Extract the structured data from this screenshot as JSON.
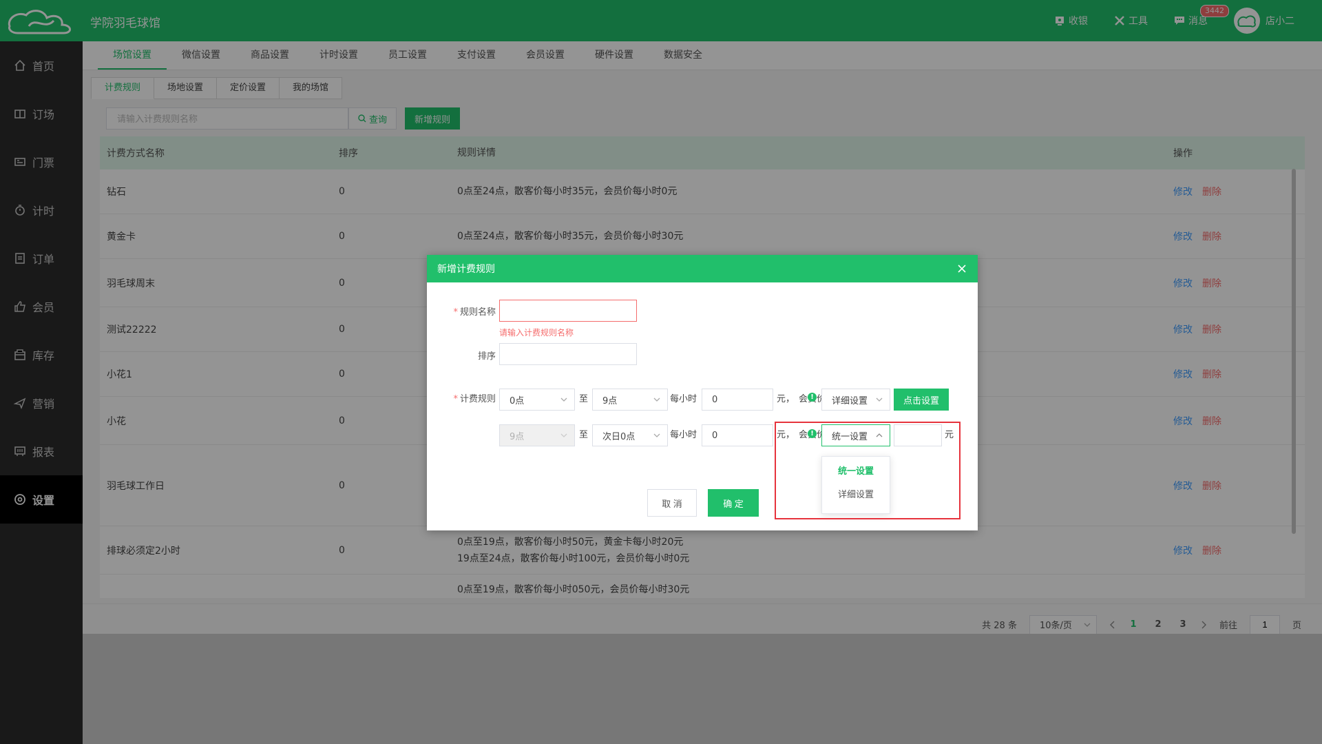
{
  "header": {
    "venue_name": "学院羽毛球馆",
    "actions": [
      {
        "label": "收银",
        "icon": "cashier-icon"
      },
      {
        "label": "工具",
        "icon": "tools-icon"
      },
      {
        "label": "消息",
        "icon": "message-icon",
        "badge": "3442"
      }
    ],
    "user_name": "店小二"
  },
  "sidebar": {
    "items": [
      {
        "label": "首页",
        "icon": "home-icon"
      },
      {
        "label": "订场",
        "icon": "booking-icon"
      },
      {
        "label": "门票",
        "icon": "ticket-icon"
      },
      {
        "label": "计时",
        "icon": "timer-icon"
      },
      {
        "label": "订单",
        "icon": "order-icon"
      },
      {
        "label": "会员",
        "icon": "member-icon"
      },
      {
        "label": "库存",
        "icon": "inventory-icon"
      },
      {
        "label": "营销",
        "icon": "marketing-icon"
      },
      {
        "label": "报表",
        "icon": "report-icon"
      },
      {
        "label": "设置",
        "icon": "settings-icon",
        "active": true
      }
    ]
  },
  "tabs": [
    "场馆设置",
    "微信设置",
    "商品设置",
    "计时设置",
    "员工设置",
    "支付设置",
    "会员设置",
    "硬件设置",
    "数据安全"
  ],
  "subtabs": [
    "计费规则",
    "场地设置",
    "定价设置",
    "我的场馆"
  ],
  "search": {
    "placeholder": "请输入计费规则名称",
    "query_label": "查询",
    "add_label": "新增规则"
  },
  "table": {
    "headers": [
      "计费方式名称",
      "排序",
      "规则详情",
      "操作"
    ],
    "edit_label": "修改",
    "delete_label": "删除",
    "rows": [
      {
        "name": "钻石",
        "order": "0",
        "detail": [
          "0点至24点，散客价每小时35元，会员价每小时0元"
        ]
      },
      {
        "name": "黄金卡",
        "order": "0",
        "detail": [
          "0点至24点，散客价每小时35元，会员价每小时30元"
        ]
      },
      {
        "name": "羽毛球周末",
        "order": "0",
        "detail": [
          ""
        ]
      },
      {
        "name": "测试22222",
        "order": "0",
        "detail": [
          ""
        ]
      },
      {
        "name": "小花1",
        "order": "0",
        "detail": [
          ""
        ]
      },
      {
        "name": "小花",
        "order": "0",
        "detail": [
          ""
        ]
      },
      {
        "name": "羽毛球工作日",
        "order": "0",
        "detail": [
          ""
        ]
      },
      {
        "name": "排球必须定2小时",
        "order": "0",
        "detail": [
          "0点至19点，散客价每小时50元，黄金卡每小时20元",
          "19点至24点，散客价每小时100元，会员价每小时0元"
        ]
      },
      {
        "name": "",
        "order": "",
        "detail": [
          "0点至19点，散客价每小时050元，会员价每小时30元"
        ]
      }
    ]
  },
  "pagination": {
    "total": "共 28 条",
    "page_size": "10条/页",
    "pages": [
      "1",
      "2",
      "3"
    ],
    "current": "1",
    "goto_label": "前往",
    "goto_value": "1",
    "page_unit": "页"
  },
  "dialog": {
    "title": "新增计费规则",
    "name_label": "规则名称",
    "name_value": "",
    "name_error": "请输入计费规则名称",
    "order_label": "排序",
    "order_value": "",
    "rule_label": "计费规则",
    "to_label": "至",
    "per_hour_label": "每小时",
    "yuan_label": "元，",
    "member_price_label": "会员价",
    "yuan_unit": "元",
    "row1": {
      "start": "0点",
      "end": "9点",
      "price": "0",
      "member_mode": "详细设置",
      "set_button": "点击设置"
    },
    "row2": {
      "start": "9点",
      "end": "次日0点",
      "price": "0",
      "member_mode": "统一设置",
      "member_price": ""
    },
    "dropdown_options": [
      "统一设置",
      "详细设置"
    ],
    "dropdown_selected": "统一设置",
    "cancel_label": "取 消",
    "confirm_label": "确 定"
  },
  "colors": {
    "brand": "#21bf6b",
    "danger": "#f56c6c",
    "link": "#409eff",
    "highlight": "#e6323c"
  }
}
